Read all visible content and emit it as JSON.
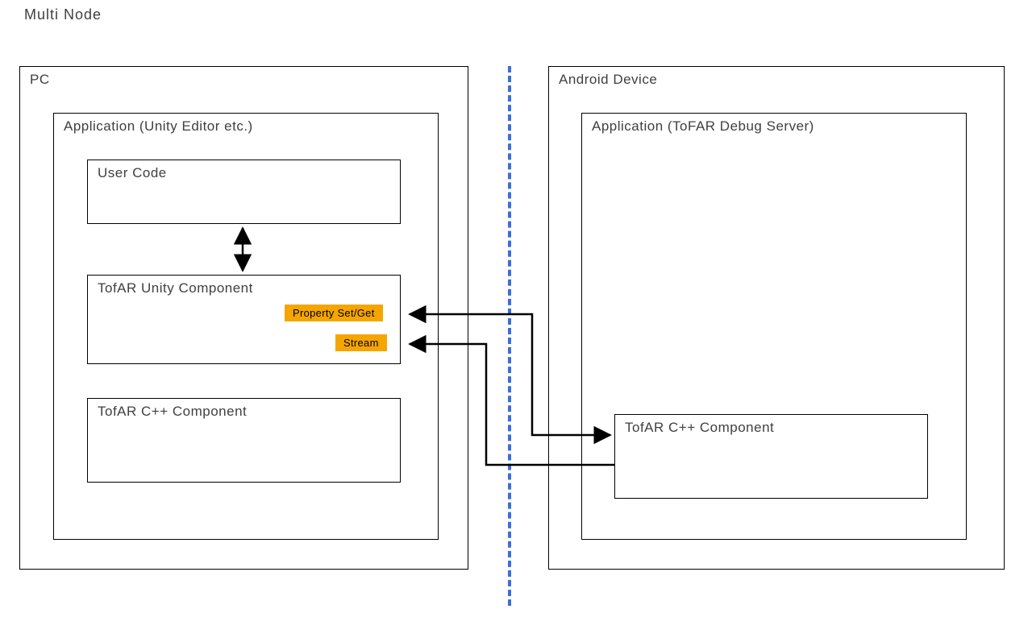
{
  "title": "Multi Node",
  "pc": {
    "label": "PC",
    "app": {
      "label": "Application (Unity Editor etc.)",
      "user_code": {
        "label": "User Code"
      },
      "unity_component": {
        "label": "TofAR Unity Component",
        "property_tag": "Property Set/Get",
        "stream_tag": "Stream"
      },
      "cpp_component": {
        "label": "TofAR C++ Component"
      }
    }
  },
  "android": {
    "label": "Android Device",
    "app": {
      "label": "Application (ToFAR Debug Server)",
      "cpp_component": {
        "label": "TofAR C++ Component"
      }
    }
  }
}
